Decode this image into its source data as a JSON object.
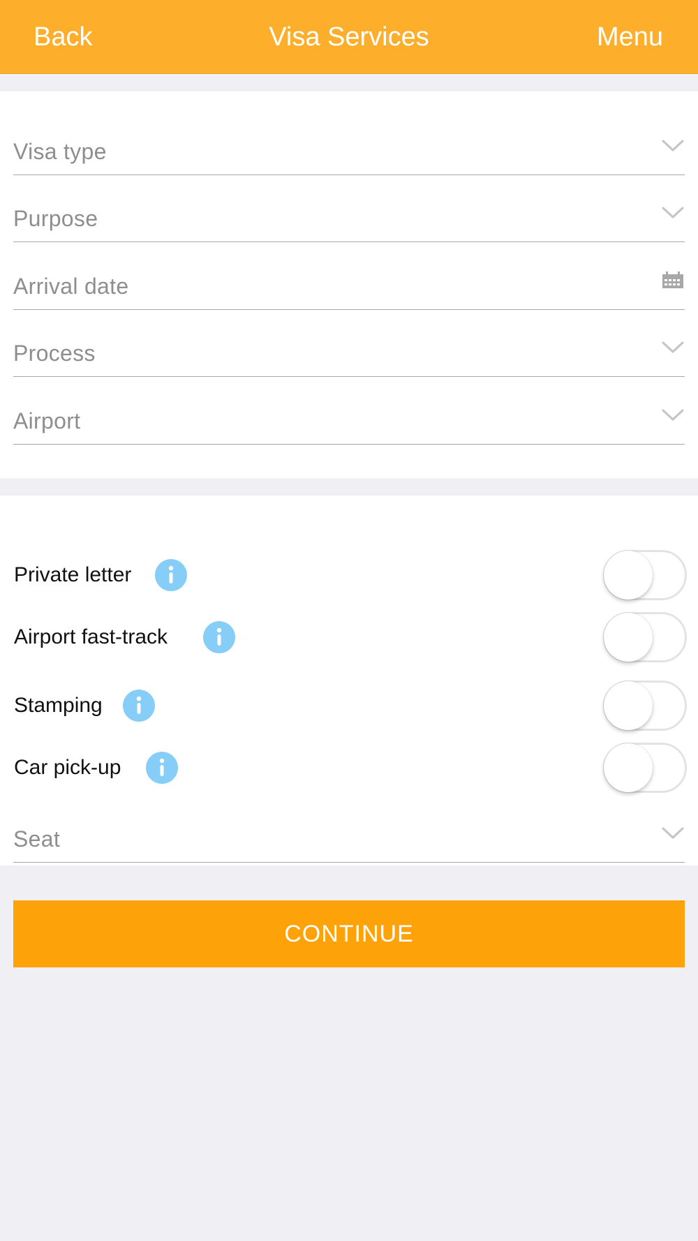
{
  "header": {
    "back_label": "Back",
    "title": "Visa Services",
    "menu_label": "Menu",
    "background_color": "#fdae2a"
  },
  "form": {
    "fields": [
      {
        "label": "Visa type",
        "icon": "chevron-down-icon"
      },
      {
        "label": "Purpose",
        "icon": "chevron-down-icon"
      },
      {
        "label": "Arrival date",
        "icon": "calendar-icon"
      },
      {
        "label": "Process",
        "icon": "chevron-down-icon"
      },
      {
        "label": "Airport",
        "icon": "chevron-down-icon"
      }
    ]
  },
  "addons": {
    "items": [
      {
        "label": "Private letter",
        "enabled": false,
        "icon": "info-icon"
      },
      {
        "label": "Airport fast-track",
        "enabled": false,
        "icon": "info-icon"
      },
      {
        "label": "Stamping",
        "enabled": false,
        "icon": "info-icon"
      },
      {
        "label": "Car pick-up",
        "enabled": false,
        "icon": "info-icon"
      }
    ],
    "seat": {
      "label": "Seat",
      "icon": "chevron-down-icon"
    }
  },
  "actions": {
    "continue_label": "CONTINUE",
    "continue_color": "#fea20a"
  },
  "colors": {
    "info_icon": "#86cdf8",
    "page_background": "#efeff4"
  }
}
